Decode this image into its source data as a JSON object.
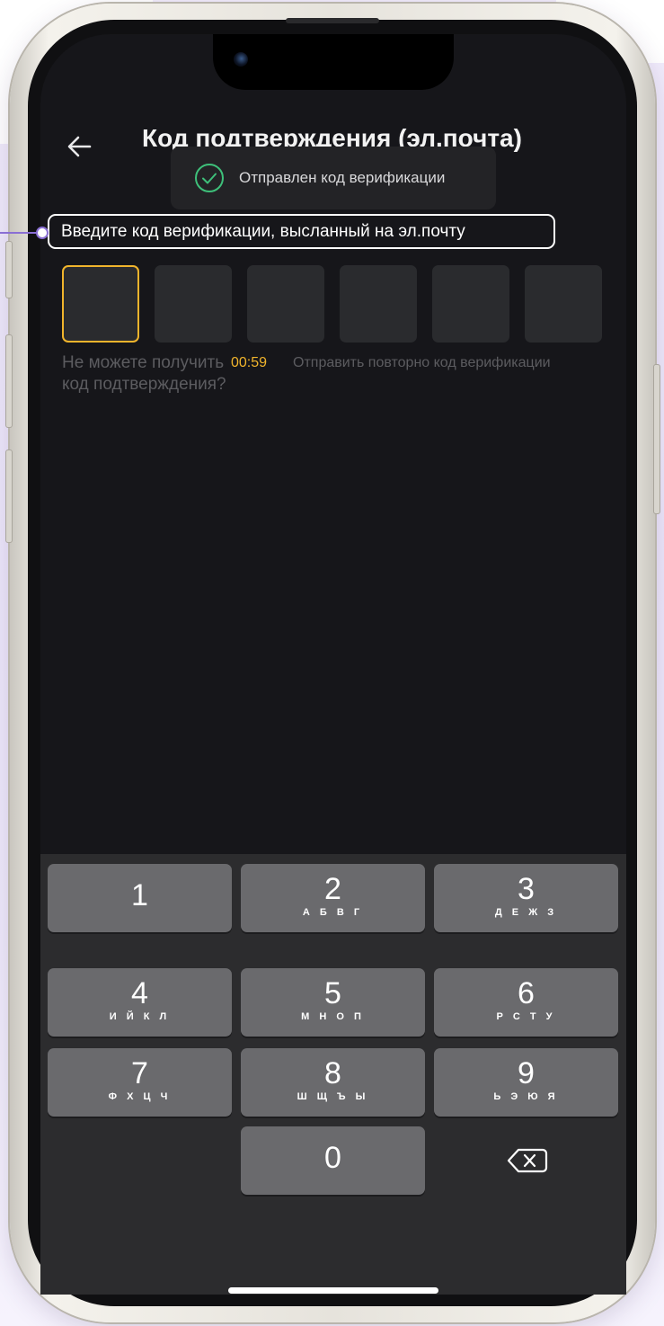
{
  "header": {
    "title": "Код подтверждения (эл.почта)"
  },
  "toast": {
    "icon": "check-circle-icon",
    "message": "Отправлен код верификации",
    "icon_color": "#3ec07a"
  },
  "instruction": {
    "text": "Введите код верификации, высланный на эл.почту"
  },
  "code_input": {
    "length": 6,
    "active_index": 0,
    "accent_color": "#f0b42c"
  },
  "help": {
    "cant_receive": "Не можете получить код подтверждения?",
    "timer": "00:59",
    "resend": "Отправить повторно код верификации"
  },
  "keypad": {
    "keys": [
      {
        "number": "1",
        "letters": ""
      },
      {
        "number": "2",
        "letters": "А Б В Г"
      },
      {
        "number": "3",
        "letters": "Д Е Ж З"
      },
      {
        "number": "4",
        "letters": "И Й К Л"
      },
      {
        "number": "5",
        "letters": "М Н О П"
      },
      {
        "number": "6",
        "letters": "Р С Т У"
      },
      {
        "number": "7",
        "letters": "Ф Х Ц Ч"
      },
      {
        "number": "8",
        "letters": "Ш Щ Ъ Ы"
      },
      {
        "number": "9",
        "letters": "Ь Э Ю Я"
      },
      {
        "number": "0",
        "letters": ""
      }
    ],
    "delete_icon": "backspace-icon"
  },
  "colors": {
    "background": "#16161a",
    "keyboard": "#2c2c2e",
    "key": "#6a6a6d",
    "callout": "#8a6fd4"
  }
}
